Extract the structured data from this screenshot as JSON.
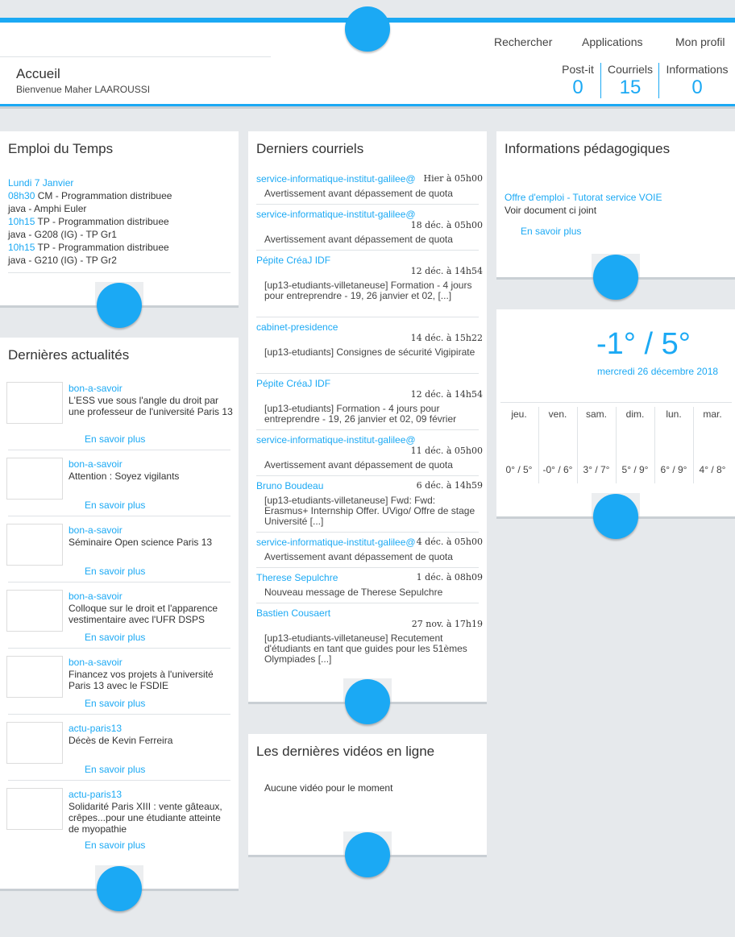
{
  "header": {
    "nav": [
      "Rechercher",
      "Applications",
      "Mon profil"
    ],
    "page_title": "Accueil",
    "welcome": "Bienvenue Maher LAAROUSSI",
    "counters": [
      {
        "label": "Post-it",
        "value": "0"
      },
      {
        "label": "Courriels",
        "value": "15"
      },
      {
        "label": "Informations",
        "value": "0"
      }
    ]
  },
  "schedule": {
    "title": "Emploi du Temps",
    "day": "Lundi 7 Janvier",
    "items": [
      {
        "time": "08h30",
        "course": "CM - Programmation distribuee",
        "room": "java - Amphi Euler"
      },
      {
        "time": "10h15",
        "course": "TP - Programmation distribuee",
        "room": "java - G208 (IG) - TP Gr1"
      },
      {
        "time": "10h15",
        "course": "TP - Programmation distribuee",
        "room": "java - G210 (IG) - TP Gr2"
      }
    ]
  },
  "news": {
    "title": "Dernières actualités",
    "more_label": "En savoir plus",
    "items": [
      {
        "source": "bon-a-savoir",
        "text": "L'ESS vue sous l'angle du droit par une professeur de l'université Paris 13"
      },
      {
        "source": "bon-a-savoir",
        "text": "Attention : Soyez vigilants"
      },
      {
        "source": "bon-a-savoir",
        "text": "Séminaire Open science Paris 13"
      },
      {
        "source": "bon-a-savoir",
        "text": "Colloque sur le droit et l'apparence vestimentaire avec l'UFR DSPS"
      },
      {
        "source": "bon-a-savoir",
        "text": "Financez vos projets à l'université Paris 13 avec le FSDIE"
      },
      {
        "source": "actu-paris13",
        "text": "Décès de Kevin Ferreira"
      },
      {
        "source": "actu-paris13",
        "text": "Solidarité Paris XIII : vente gâteaux, crêpes...pour une étudiante atteinte de myopathie"
      }
    ]
  },
  "mails": {
    "title": "Derniers courriels",
    "items": [
      {
        "from": "service-informatique-institut-galilee@",
        "date": "Hier à 05h00",
        "subject": "Avertissement avant dépassement de quota"
      },
      {
        "from": "service-informatique-institut-galilee@",
        "date": "18 déc. à 05h00",
        "subject": "Avertissement avant dépassement de quota"
      },
      {
        "from": "Pépite CréaJ IDF",
        "date": "12 déc. à 14h54",
        "subject": "[up13-etudiants-villetaneuse] Formation - 4 jours pour entreprendre - 19, 26 janvier et 02, [...]"
      },
      {
        "from": "cabinet-presidence",
        "date": "14 déc. à 15h22",
        "subject": "[up13-etudiants] Consignes de sécurité Vigipirate"
      },
      {
        "from": "Pépite CréaJ IDF",
        "date": "12 déc. à 14h54",
        "subject": "[up13-etudiants] Formation - 4 jours pour entreprendre - 19, 26 janvier et 02, 09 février"
      },
      {
        "from": "service-informatique-institut-galilee@",
        "date": "11 déc. à 05h00",
        "subject": "Avertissement avant dépassement de quota"
      },
      {
        "from": "Bruno Boudeau",
        "date": "6 déc. à 14h59",
        "subject": "[up13-etudiants-villetaneuse] Fwd: Fwd: Erasmus+ Internship Offer. UVigo/ Offre de stage Université [...]"
      },
      {
        "from": "service-informatique-institut-galilee@",
        "date": "4 déc. à 05h00",
        "subject": "Avertissement avant dépassement de quota"
      },
      {
        "from": "Therese Sepulchre",
        "date": "1 déc. à 08h09",
        "subject": "Nouveau message de Therese Sepulchre"
      },
      {
        "from": "Bastien Cousaert",
        "date": "27 nov. à 17h19",
        "subject": "[up13-etudiants-villetaneuse] Recutement d'étudiants en tant que guides pour les 51èmes Olympiades [...]"
      }
    ]
  },
  "videos": {
    "title": "Les dernières vidéos en ligne",
    "empty": "Aucune vidéo pour le moment"
  },
  "info": {
    "title": "Informations pédagogiques",
    "link": "Offre d'emploi - Tutorat service VOIE",
    "text": "Voir document ci joint",
    "more": "En savoir plus"
  },
  "weather": {
    "temp": "-1° / 5°",
    "date": "mercredi 26 décembre 2018",
    "days": [
      {
        "day": "jeu.",
        "temp": "0° / 5°"
      },
      {
        "day": "ven.",
        "temp": "-0° / 6°"
      },
      {
        "day": "sam.",
        "temp": "3° / 7°"
      },
      {
        "day": "dim.",
        "temp": "5° / 9°"
      },
      {
        "day": "lun.",
        "temp": "6° / 9°"
      },
      {
        "day": "mar.",
        "temp": "4° / 8°"
      }
    ]
  },
  "colors": {
    "accent": "#1ba9f4",
    "background": "#e6e9ec"
  }
}
